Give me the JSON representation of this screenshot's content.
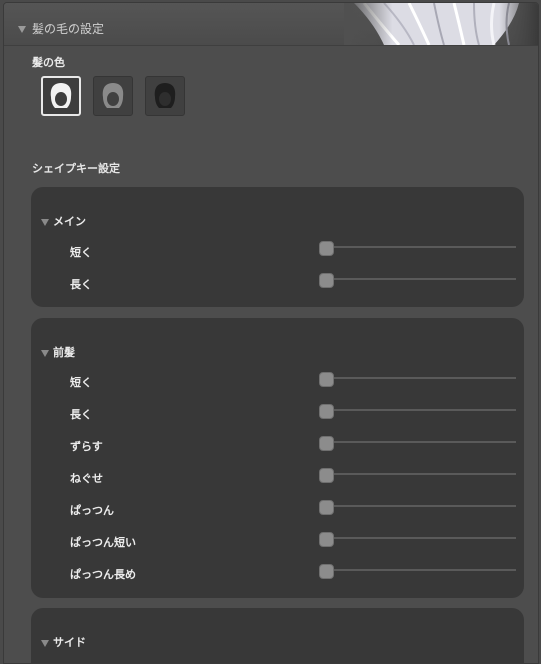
{
  "header": {
    "title": "髪の毛の設定"
  },
  "hair_color": {
    "label": "髪の色",
    "options": [
      {
        "icon": "hair-white-icon",
        "color": "#f2f2f2",
        "selected": true
      },
      {
        "icon": "hair-gray-icon",
        "color": "#8a8a8a",
        "selected": false
      },
      {
        "icon": "hair-black-icon",
        "color": "#1e1e1e",
        "selected": false
      }
    ]
  },
  "shape_keys": {
    "label": "シェイプキー設定",
    "sections": [
      {
        "title": "メイン",
        "sliders": [
          {
            "label": "短く",
            "value": 0
          },
          {
            "label": "長く",
            "value": 0
          }
        ]
      },
      {
        "title": "前髪",
        "sliders": [
          {
            "label": "短く",
            "value": 0
          },
          {
            "label": "長く",
            "value": 0
          },
          {
            "label": "ずらす",
            "value": 0
          },
          {
            "label": "ねぐせ",
            "value": 0
          },
          {
            "label": "ぱっつん",
            "value": 0
          },
          {
            "label": "ぱっつん短い",
            "value": 0
          },
          {
            "label": "ぱっつん長め",
            "value": 0
          }
        ]
      },
      {
        "title": "サイド",
        "sliders": []
      }
    ]
  }
}
